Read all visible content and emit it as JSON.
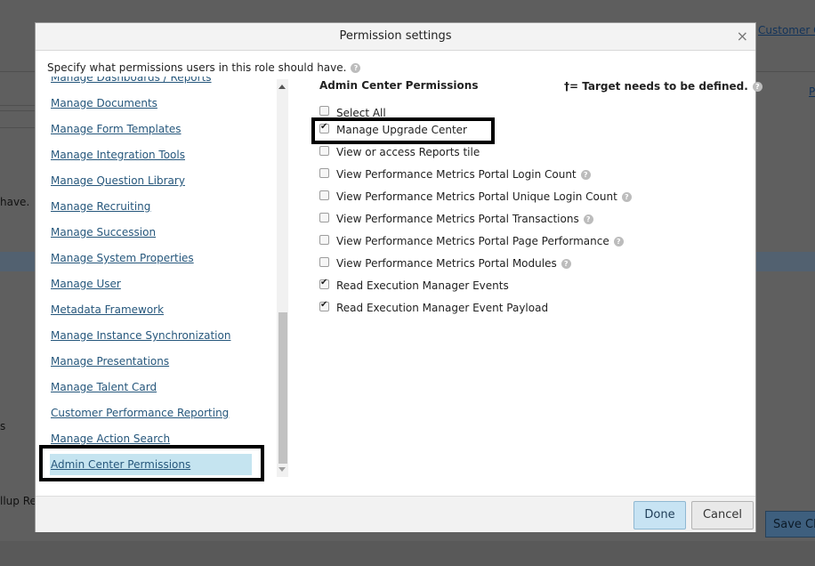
{
  "background": {
    "left_text_1": "have.",
    "left_text_2": "s",
    "left_text_3": "llup Re",
    "top_right_link": "Customer C",
    "right_link_2": "P",
    "save_button": "Save Ch"
  },
  "modal": {
    "title": "Permission settings",
    "close_glyph": "×",
    "instruction": "Specify what permissions users in this role should have.",
    "help_glyph": "?",
    "categories": [
      {
        "label": "Manage Dashboards / Reports"
      },
      {
        "label": "Manage Documents"
      },
      {
        "label": "Manage Form Templates"
      },
      {
        "label": "Manage Integration Tools"
      },
      {
        "label": "Manage Question Library"
      },
      {
        "label": "Manage Recruiting"
      },
      {
        "label": "Manage Succession"
      },
      {
        "label": "Manage System Properties"
      },
      {
        "label": "Manage User"
      },
      {
        "label": "Metadata Framework"
      },
      {
        "label": "Manage Instance Synchronization"
      },
      {
        "label": "Manage Presentations"
      },
      {
        "label": "Manage Talent Card"
      },
      {
        "label": "Customer Performance Reporting"
      },
      {
        "label": "Manage Action Search"
      },
      {
        "label": "Admin Center Permissions"
      }
    ],
    "selected_category": "Admin Center Permissions",
    "permissions_title": "Admin Center Permissions",
    "legend": "†= Target needs to be defined.",
    "permissions": [
      {
        "label": "Select All",
        "checked": false,
        "help": false
      },
      {
        "label": "Manage Upgrade Center",
        "checked": true,
        "help": false
      },
      {
        "label": "View or access Reports tile",
        "checked": false,
        "help": false
      },
      {
        "label": "View Performance Metrics Portal Login Count",
        "checked": false,
        "help": true
      },
      {
        "label": "View Performance Metrics Portal Unique Login Count",
        "checked": false,
        "help": true
      },
      {
        "label": "View Performance Metrics Portal Transactions",
        "checked": false,
        "help": true
      },
      {
        "label": "View Performance Metrics Portal Page Performance",
        "checked": false,
        "help": true
      },
      {
        "label": "View Performance Metrics Portal Modules",
        "checked": false,
        "help": true
      },
      {
        "label": "Read Execution Manager Events",
        "checked": true,
        "help": false
      },
      {
        "label": "Read Execution Manager Event Payload",
        "checked": true,
        "help": false
      }
    ],
    "done_label": "Done",
    "cancel_label": "Cancel"
  },
  "colors": {
    "link": "#26577c",
    "selected_row": "#c5e4f0",
    "done_button": "#c7e3f3"
  }
}
